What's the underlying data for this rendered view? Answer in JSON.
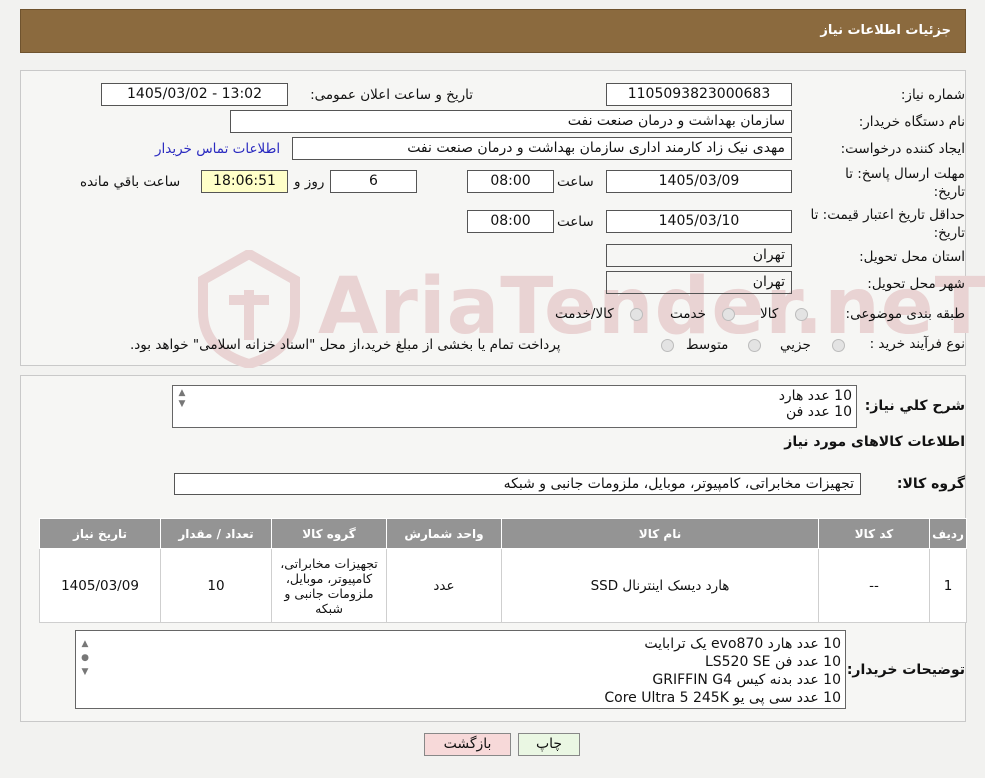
{
  "header": {
    "title": "جزئیات اطلاعات نیاز"
  },
  "form": {
    "need_number_label": "شماره نیاز:",
    "need_number": "1105093823000683",
    "announce_label": "تاریخ و ساعت اعلان عمومی:",
    "announce_value": "1405/03/02 - 13:02",
    "buyer_label": "نام دستگاه خریدار:",
    "buyer": "سازمان بهداشت و درمان صنعت نفت",
    "requester_label": "ایجاد کننده درخواست:",
    "requester": "مهدی نیک زاد کارمند اداری سازمان بهداشت و درمان صنعت نفت",
    "contact_link": "اطلاعات تماس خریدار",
    "deadline_label_1": "مهلت ارسال پاسخ: تا",
    "deadline_label_2": "تاریخ:",
    "deadline_date": "1405/03/09",
    "time_label": "ساعت",
    "deadline_time": "08:00",
    "days_value": "6",
    "days_label": "روز و",
    "remaining_time": "18:06:51",
    "remaining_label": "ساعت باقي مانده",
    "validity_label_1": "حداقل تاریخ اعتبار قیمت: تا",
    "validity_label_2": "تاریخ:",
    "validity_date": "1405/03/10",
    "validity_time": "08:00",
    "province_label": "استان محل تحویل:",
    "province": "تهران",
    "city_label": "شهر محل تحویل:",
    "city": "تهران",
    "category_label": "طبقه بندی موضوعی:",
    "category_options": [
      "کالا",
      "خدمت",
      "کالا/خدمت"
    ],
    "process_label": "نوع فرآیند خرید :",
    "process_options": [
      "جزیي",
      "متوسط"
    ],
    "process_note": "پرداخت تمام یا بخشی از مبلغ خرید،از محل \"اسناد خزانه اسلامی\" خواهد بود."
  },
  "summary": {
    "label": "شرح كلي نياز:",
    "lines": [
      "10 عدد هارد",
      "10 عدد فن"
    ],
    "goods_title": "اطلاعات کالاهای مورد نیاز",
    "group_label": "گروه کالا:",
    "group_value": "تجهیزات مخابراتی، کامپیوتر، موبایل، ملزومات جانبی و شبکه"
  },
  "table": {
    "headers": [
      "ردیف",
      "کد کالا",
      "نام کالا",
      "واحد شمارش",
      "گروه کالا",
      "تعداد / مقدار",
      "تاریخ نیاز"
    ],
    "rows": [
      {
        "row": "1",
        "code": "--",
        "name": "هارد دیسک اینترنال SSD",
        "unit": "عدد",
        "group": "تجهیزات مخابراتی، کامپیوتر، موبایل، ملزومات جانبی و شبکه",
        "qty": "10",
        "date": "1405/03/09"
      }
    ]
  },
  "buyer_notes": {
    "label": "توضیحات خریدار:",
    "lines": [
      "10 عدد هارد evo870 یک ترابایت",
      "10 عدد فن LS520 SE",
      "10 عدد بدنه کیس GRIFFIN G4",
      "10 عدد سی پی یو Core Ultra 5 245K"
    ]
  },
  "buttons": {
    "print": "چاپ",
    "back": "بازگشت"
  },
  "colors": {
    "header": "#8b6a3e",
    "back_button": "#f7d9d9",
    "print_button": "#eaf7e3",
    "table_header": "#949494"
  }
}
